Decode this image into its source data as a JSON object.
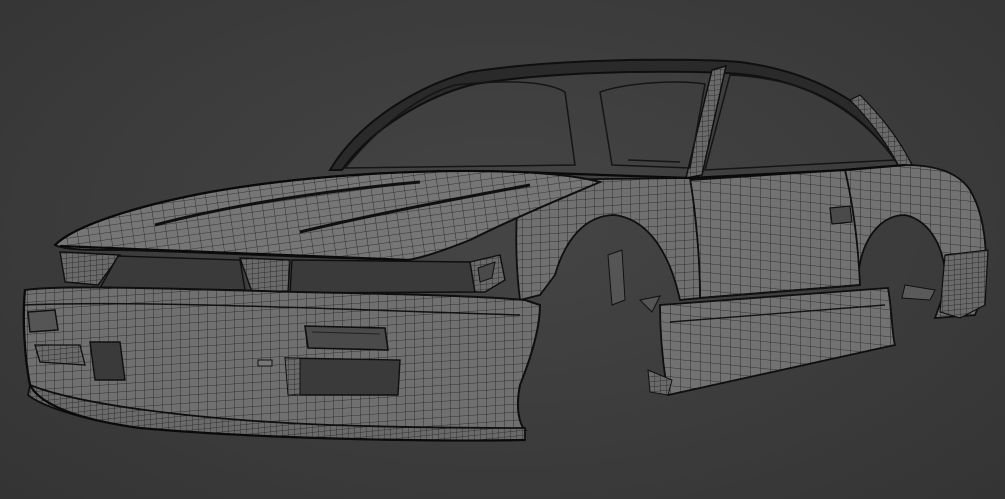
{
  "viewport": {
    "background_color": "#3c3c3c"
  },
  "model": {
    "display_mode": "wireframe-on-shaded",
    "shaded_color": "#6e6e6e",
    "wire_color": "#1e1e1e",
    "outline_color": "#101010"
  }
}
